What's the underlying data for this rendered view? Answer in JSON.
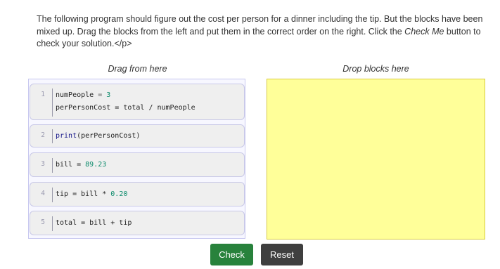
{
  "instructions": {
    "part1": "The following program should figure out the cost per person for a dinner including the tip. But the blocks have been mixed up. Drag the blocks from the left and put them in the correct order on the right. Click the ",
    "emphasis": "Check Me",
    "part2": " button to check your solution.</p>"
  },
  "headings": {
    "drag": "Drag from here",
    "drop": "Drop blocks here"
  },
  "blocks": [
    {
      "number": "1",
      "lines": [
        [
          "numPeople",
          " = ",
          "3"
        ],
        [
          "perPersonCost = total / numPeople"
        ]
      ]
    },
    {
      "number": "2",
      "lines": [
        [
          "print",
          "(perPersonCost)"
        ]
      ]
    },
    {
      "number": "3",
      "lines": [
        [
          "bill = ",
          "89.23"
        ]
      ]
    },
    {
      "number": "4",
      "lines": [
        [
          "tip = bill * ",
          "0.20"
        ]
      ]
    },
    {
      "number": "5",
      "lines": [
        [
          "total = bill + tip"
        ]
      ]
    }
  ],
  "buttons": {
    "check": "Check",
    "reset": "Reset"
  },
  "colors": {
    "drop_area": "#ffff99",
    "check_button": "#28823c",
    "reset_button": "#3f3f3f"
  }
}
